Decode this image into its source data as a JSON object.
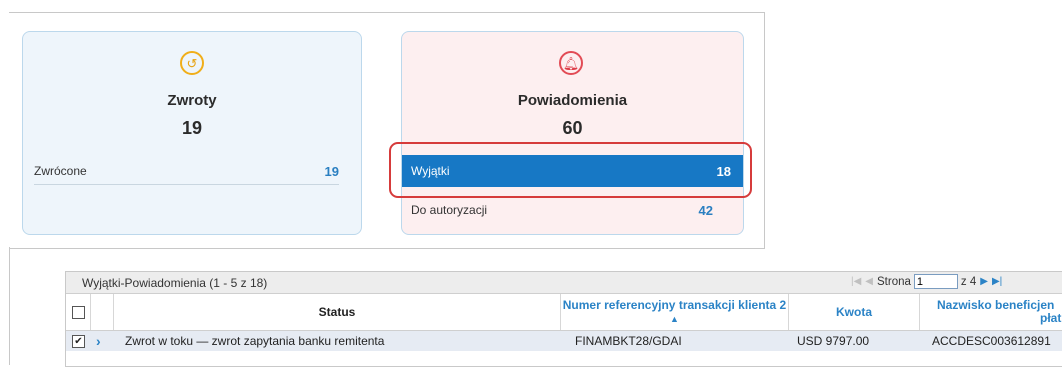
{
  "cards": {
    "returns": {
      "icon": "return-icon",
      "icon_color": "#f0ae19",
      "title": "Zwroty",
      "count": "19",
      "rows": [
        {
          "label": "Zwrócone",
          "value": "19"
        }
      ]
    },
    "notifications": {
      "icon": "bell-icon",
      "icon_color": "#e24b55",
      "title": "Powiadomienia",
      "count": "60",
      "rows": [
        {
          "label": "Wyjątki",
          "value": "18",
          "selected": true
        },
        {
          "label": "Do autoryzacji",
          "value": "42"
        }
      ]
    }
  },
  "grid": {
    "title": "Wyjątki-Powiadomienia (1 - 5 z 18)",
    "pager": {
      "page_label": "Strona",
      "page_value": "1",
      "of_label": "z 4"
    },
    "columns": [
      {
        "label": ""
      },
      {
        "label": "Status"
      },
      {
        "label": "Numer referencyjny transakcji klienta",
        "sort_index": "2",
        "sort": "▲"
      },
      {
        "label": "Kwota"
      },
      {
        "label": "Nazwisko beneficjen"
      },
      {
        "label": "płat"
      }
    ],
    "rows": [
      {
        "checked": "✔",
        "expand": "›",
        "status": "Zwrot w toku — zwrot zapytania banku remitenta",
        "reference": "FINAMBKT28/GDAI",
        "amount": "USD 9797.00",
        "beneficiary": "ACCDESC003612891"
      }
    ]
  },
  "colors": {
    "selected_row": "#1778c5",
    "accent": "#2b83c6",
    "highlight_border": "#d63b3b"
  }
}
